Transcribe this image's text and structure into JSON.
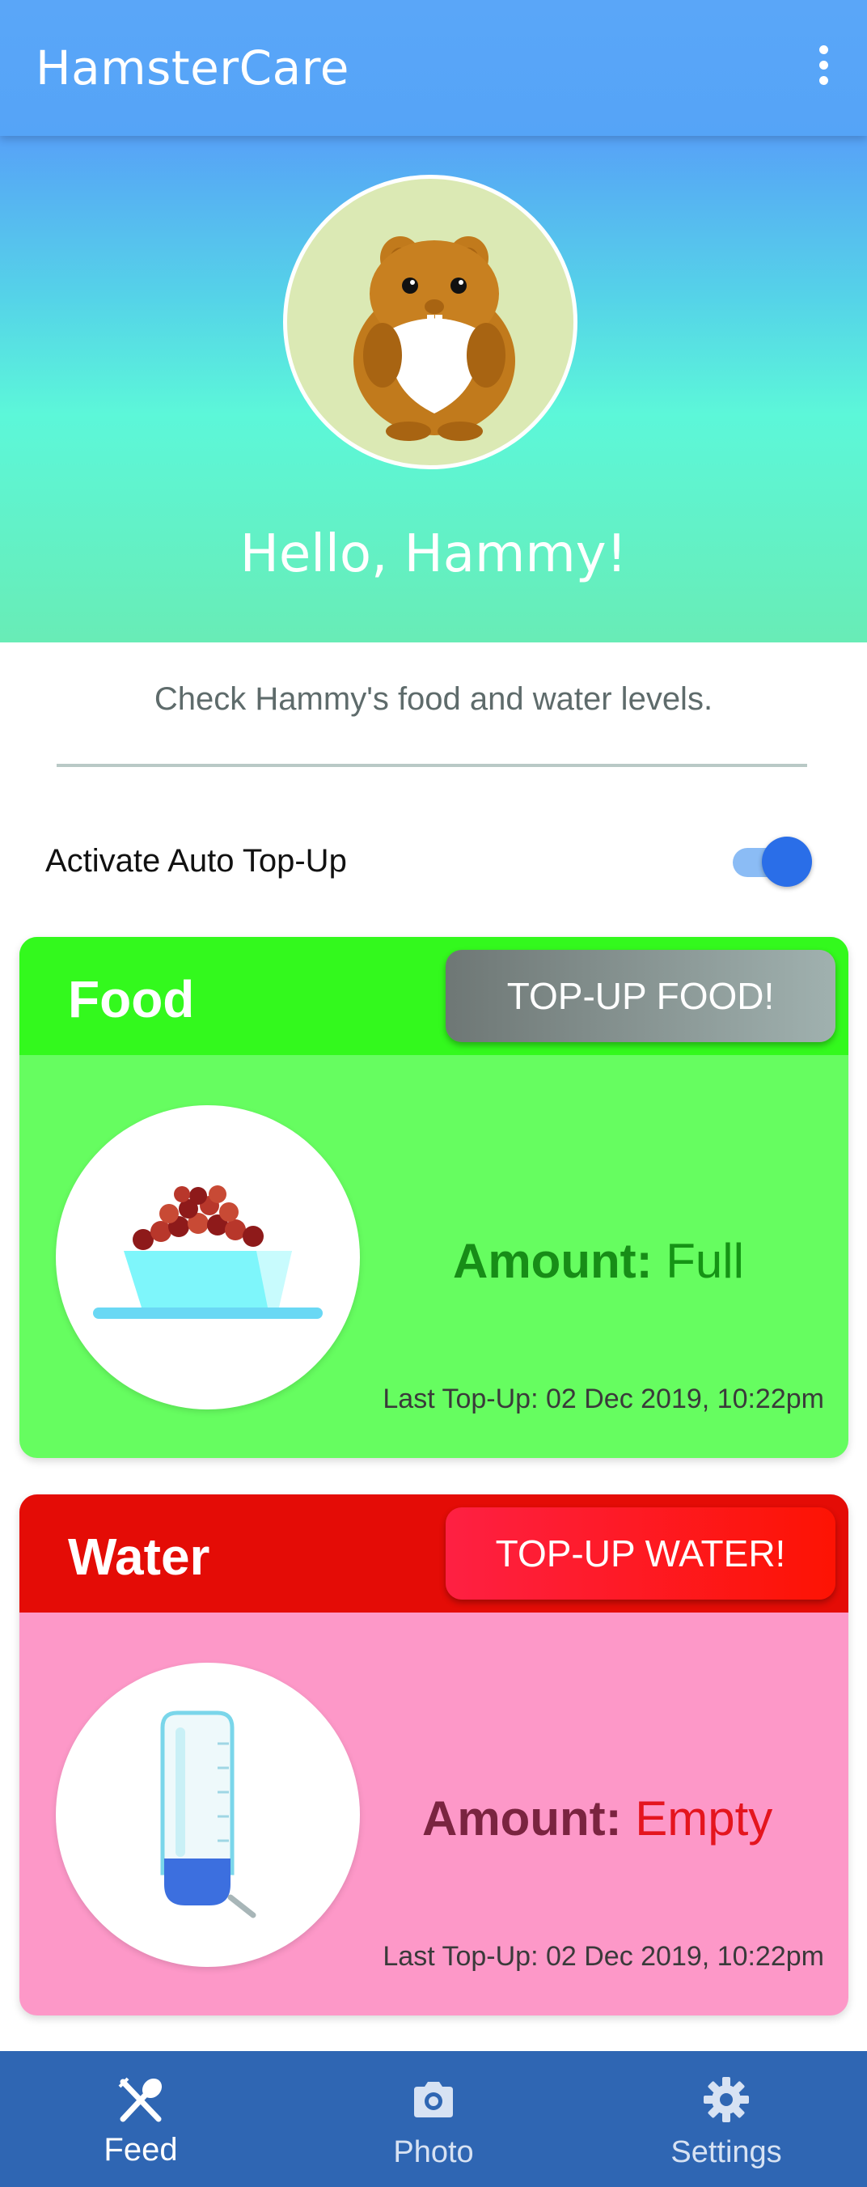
{
  "app_bar": {
    "title": "HamsterCare",
    "menu_icon": "more-vert-icon"
  },
  "hero": {
    "avatar_icon": "hamster-icon",
    "greeting": "Hello, Hammy!"
  },
  "intro": {
    "subtitle": "Check Hammy's food and water levels."
  },
  "auto_topup": {
    "label": "Activate Auto Top-Up",
    "enabled": true
  },
  "food": {
    "title": "Food",
    "button": "TOP-UP FOOD!",
    "icon": "food-bowl-icon",
    "amount_label": "Amount:",
    "amount_value": "Full",
    "last_topup": "Last Top-Up: 02 Dec 2019, 10:22pm",
    "colors": {
      "header": "#33f91d",
      "body": "#66fd60"
    }
  },
  "water": {
    "title": "Water",
    "button": "TOP-UP WATER!",
    "icon": "water-bottle-icon",
    "amount_label": "Amount:",
    "amount_value": "Empty",
    "last_topup": "Last Top-Up: 02 Dec 2019, 10:22pm",
    "colors": {
      "header": "#e40c06",
      "body": "#fd98c8"
    }
  },
  "bottom_nav": {
    "items": [
      {
        "label": "Feed",
        "icon": "fork-spoon-icon",
        "selected": true
      },
      {
        "label": "Photo",
        "icon": "camera-icon",
        "selected": false
      },
      {
        "label": "Settings",
        "icon": "gear-icon",
        "selected": false
      }
    ]
  }
}
